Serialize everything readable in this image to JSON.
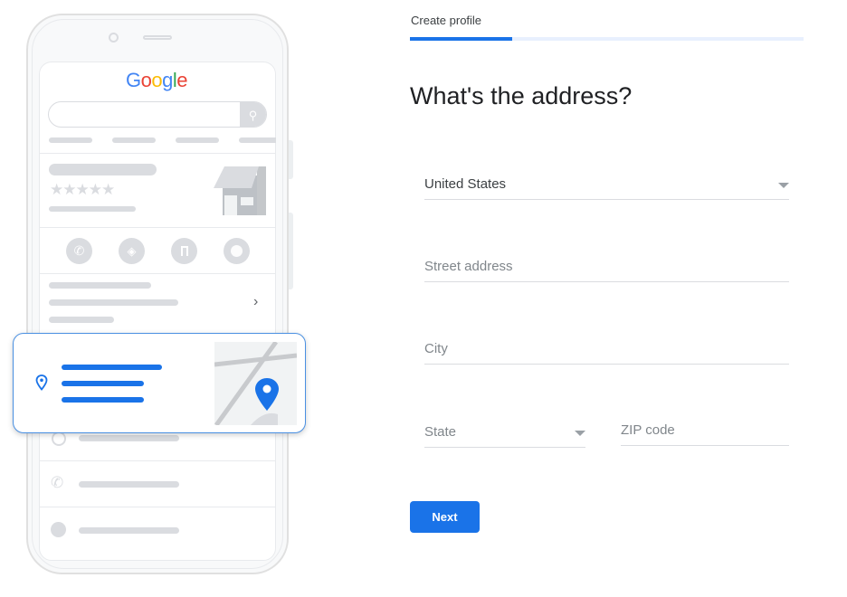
{
  "illustration": {
    "logo": "Google",
    "logo_colors": [
      "#4285f4",
      "#ea4335",
      "#fbbc05",
      "#4285f4",
      "#34a853",
      "#ea4335"
    ],
    "accent": "#1a73e8"
  },
  "header": {
    "step_label": "Create profile",
    "progress_percent": 26
  },
  "main": {
    "title": "What's the address?",
    "country": {
      "value": "United States"
    },
    "street": {
      "placeholder": "Street address"
    },
    "city": {
      "placeholder": "City"
    },
    "state": {
      "placeholder": "State"
    },
    "zip": {
      "placeholder": "ZIP code"
    },
    "next_label": "Next"
  }
}
